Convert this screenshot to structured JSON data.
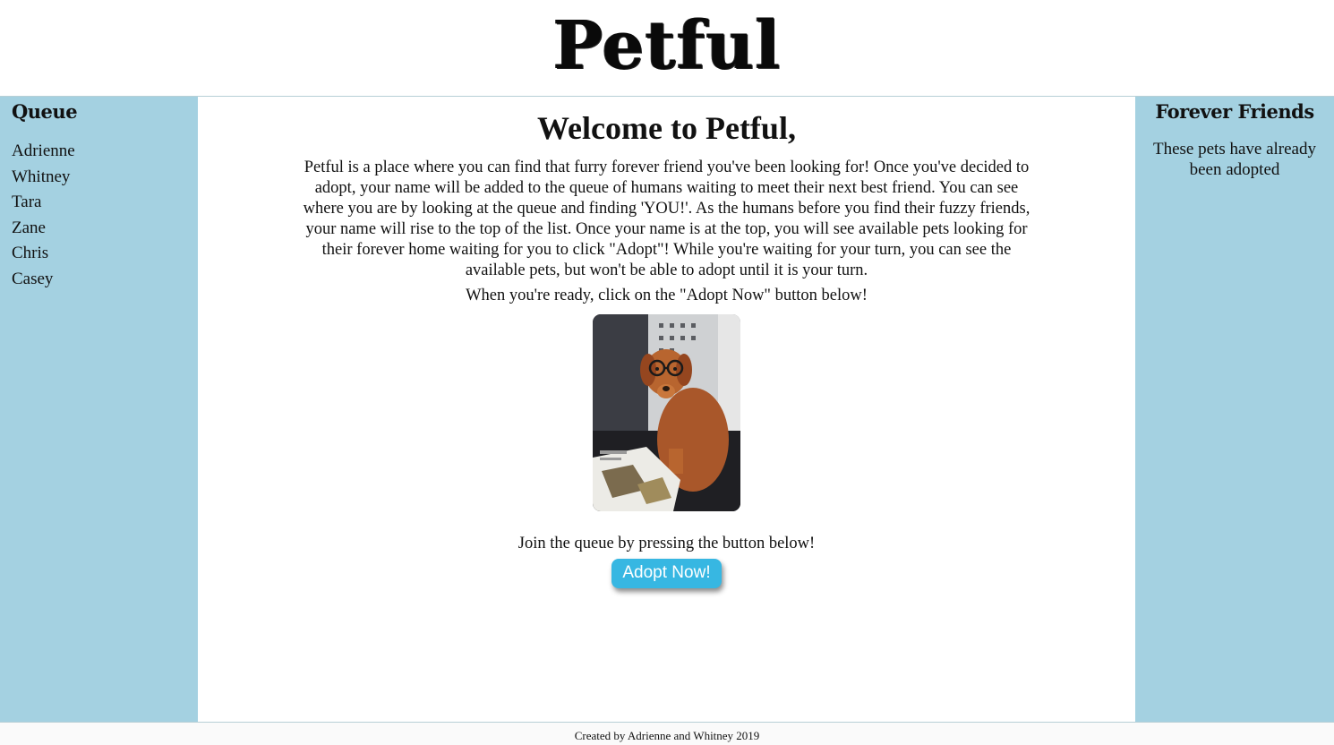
{
  "header": {
    "title": "Petful"
  },
  "queue": {
    "title": "Queue",
    "people": [
      "Adrienne",
      "Whitney",
      "Tara",
      "Zane",
      "Chris",
      "Casey"
    ]
  },
  "main": {
    "welcome": "Welcome to Petful,",
    "intro": "Petful is a place where you can find that furry forever friend you've been looking for! Once you've decided to adopt, your name will be added to the queue of humans waiting to meet their next best friend. You can see where you are by looking at the queue and finding 'YOU!'. As the humans before you find their fuzzy friends, your name will rise to the top of the list. Once your name is at the top, you will see available pets looking for their forever home waiting for you to click \"Adopt\"! While you're waiting for your turn, you can see the available pets, but won't be able to adopt until it is your turn.",
    "ready": "When you're ready, click on the \"Adopt Now\" button below!",
    "join": "Join the queue by pressing the button below!",
    "adopt_button": "Adopt Now!"
  },
  "adopted": {
    "title": "Forever Friends",
    "text": "These pets have already been adopted"
  },
  "footer": {
    "credit": "Created by Adrienne and Whitney 2019"
  },
  "colors": {
    "sidebar": "#a4d1e1",
    "button": "#37b7e2"
  }
}
